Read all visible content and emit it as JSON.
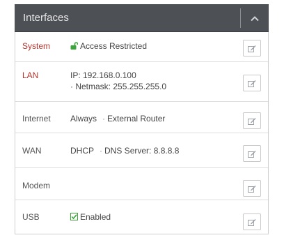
{
  "panel": {
    "title": "Interfaces",
    "collapse_icon": "chevron-up-icon"
  },
  "rows": [
    {
      "label": "System",
      "value": "Access Restricted",
      "icon": "unlock-icon",
      "label_color": "#b5342d"
    },
    {
      "label": "LAN",
      "value": "IP: 192.168.0.100",
      "value2": "· Netmask: 255.255.255.0",
      "label_color": "#b5342d"
    },
    {
      "label": "Internet",
      "value": "Always",
      "value2": "External Router"
    },
    {
      "label": "WAN",
      "value": "DHCP",
      "value2": "DNS Server: 8.8.8.8"
    },
    {
      "label": "Modem",
      "value": ""
    },
    {
      "label": "USB",
      "value": "Enabled",
      "icon": "checkbox-checked-icon"
    }
  ],
  "colors": {
    "header_bg": "#4d5156",
    "label_red": "#b5342d",
    "icon_green": "#3aa63a"
  }
}
